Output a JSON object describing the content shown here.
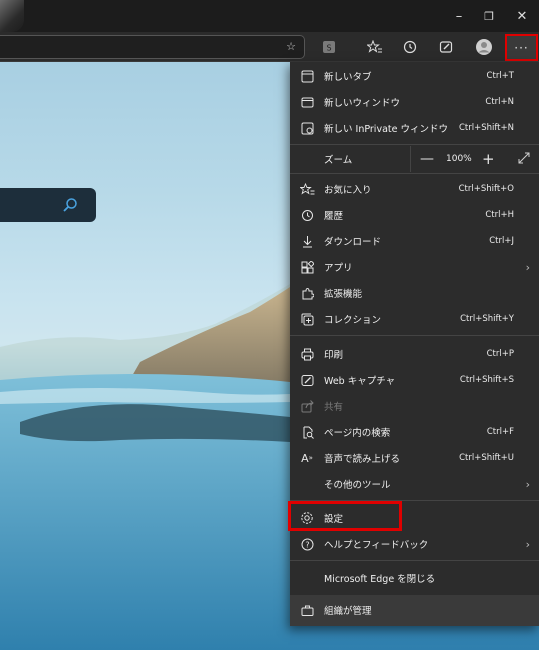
{
  "window": {
    "minimize": "–",
    "maximize": "❐",
    "close": "✕"
  },
  "toolbar": {
    "more_label": "···"
  },
  "menu": {
    "new_tab": {
      "label": "新しいタブ",
      "shortcut": "Ctrl+T"
    },
    "new_window": {
      "label": "新しいウィンドウ",
      "shortcut": "Ctrl+N"
    },
    "new_inprivate": {
      "label": "新しい InPrivate ウィンドウ",
      "shortcut": "Ctrl+Shift+N"
    },
    "zoom": {
      "label": "ズーム",
      "minus": "—",
      "value": "100%",
      "plus": "+"
    },
    "favorites": {
      "label": "お気に入り",
      "shortcut": "Ctrl+Shift+O"
    },
    "history": {
      "label": "履歴",
      "shortcut": "Ctrl+H"
    },
    "downloads": {
      "label": "ダウンロード",
      "shortcut": "Ctrl+J"
    },
    "apps": {
      "label": "アプリ"
    },
    "extensions": {
      "label": "拡張機能"
    },
    "collections": {
      "label": "コレクション",
      "shortcut": "Ctrl+Shift+Y"
    },
    "print": {
      "label": "印刷",
      "shortcut": "Ctrl+P"
    },
    "web_capture": {
      "label": "Web キャプチャ",
      "shortcut": "Ctrl+Shift+S"
    },
    "share": {
      "label": "共有"
    },
    "find": {
      "label": "ページ内の検索",
      "shortcut": "Ctrl+F"
    },
    "read_aloud": {
      "label": "音声で読み上げる",
      "shortcut": "Ctrl+Shift+U"
    },
    "more_tools": {
      "label": "その他のツール"
    },
    "settings": {
      "label": "設定"
    },
    "help": {
      "label": "ヘルプとフィードバック"
    },
    "close_edge": {
      "label": "Microsoft Edge を閉じる"
    },
    "managed": {
      "label": "組織が管理"
    }
  },
  "colors": {
    "highlight": "#e00000",
    "menu_bg": "#2c2c2c"
  }
}
